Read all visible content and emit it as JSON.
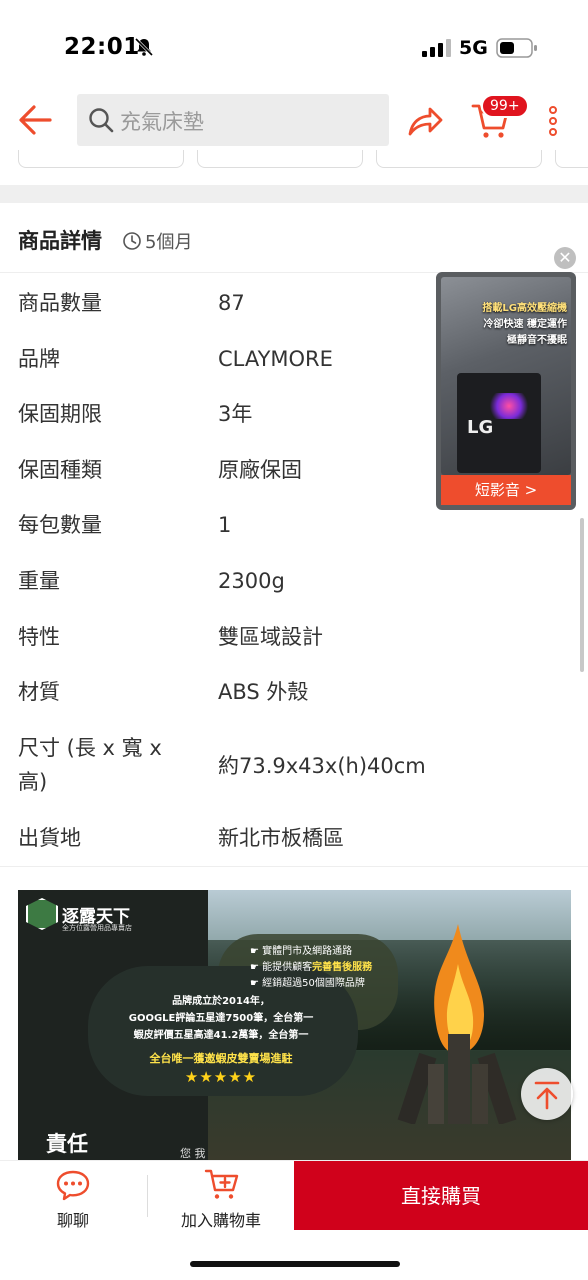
{
  "status_bar": {
    "time": "22:01",
    "network": "5G"
  },
  "nav": {
    "search_placeholder": "充氣床墊",
    "cart_badge": "99+"
  },
  "details": {
    "title": "商品詳情",
    "age": "5個月",
    "specs": [
      {
        "label": "商品數量",
        "value": "87"
      },
      {
        "label": "品牌",
        "value": "CLAYMORE"
      },
      {
        "label": "保固期限",
        "value": "3年"
      },
      {
        "label": "保固種類",
        "value": "原廠保固"
      },
      {
        "label": "每包數量",
        "value": "1"
      },
      {
        "label": "重量",
        "value": "2300g"
      },
      {
        "label": "特性",
        "value": "雙區域設計"
      },
      {
        "label": "材質",
        "value": "ABS 外殼"
      },
      {
        "label": "尺寸 (長 x 寬 x",
        "label2": "高)",
        "value": "約73.9x43x(h)40cm"
      },
      {
        "label": "出貨地",
        "value": "新北市板橋區"
      }
    ]
  },
  "video": {
    "caption_1": "搭載LG高效壓縮機",
    "caption_2": "冷卻快速 穩定運作",
    "caption_3": "極靜音不擾眠",
    "lg_text": "LG",
    "cta": "短影音 >"
  },
  "banner": {
    "brand": "逐露天下",
    "brand_sub": "全方位露營用品專賣店",
    "features": [
      "實體門市及網路通路",
      "能提供顧客完善售後服務",
      "經銷超過50個國際品牌"
    ],
    "feature_highlight": "完善售後服務",
    "para_1": "品牌成立於2014年，",
    "para_2": "GOOGLE評論五星達7500筆，全台第一",
    "para_3": "蝦皮評價五星高達41.2萬筆，全台第一",
    "highlight": "全台唯一獲邀蝦皮雙賣場進駐",
    "stars": "★★★★★",
    "bottom_text": "責任",
    "bottom_small": "您 我"
  },
  "bottom_bar": {
    "chat": "聊聊",
    "add_cart": "加入購物車",
    "buy_now": "直接購買"
  },
  "colors": {
    "accent": "#ee4d2d",
    "buy": "#d0011b"
  }
}
